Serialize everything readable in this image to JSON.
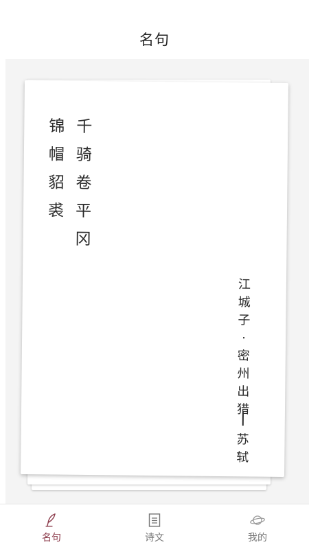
{
  "header": {
    "title": "名句"
  },
  "card": {
    "verse_lines": [
      [
        "千",
        "骑",
        "卷",
        "平",
        "冈"
      ],
      [
        "锦",
        "帽",
        "貂",
        "裘"
      ]
    ],
    "source_chars": [
      "江",
      "城",
      "子",
      "·",
      "密",
      "州",
      "出",
      "猎"
    ],
    "author_chars": [
      "苏",
      "轼"
    ]
  },
  "tabs": [
    {
      "label": "名句",
      "icon": "quill-icon",
      "active": true
    },
    {
      "label": "诗文",
      "icon": "document-icon",
      "active": false
    },
    {
      "label": "我的",
      "icon": "planet-icon",
      "active": false
    }
  ],
  "colors": {
    "accent": "#8b3a4a",
    "inactive": "#777777",
    "text": "#2a2a2a"
  }
}
